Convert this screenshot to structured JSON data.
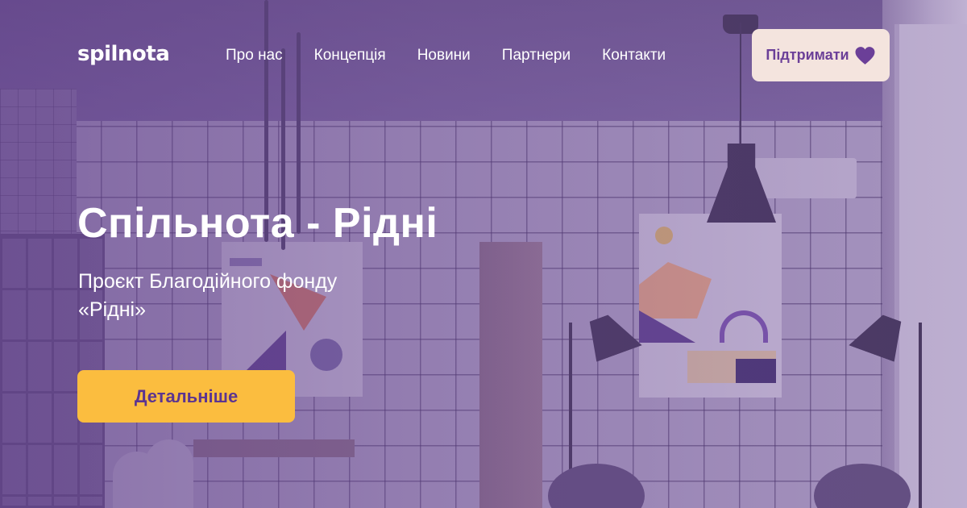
{
  "header": {
    "logo": "spilnota",
    "nav": [
      {
        "label": "Про нас"
      },
      {
        "label": "Концепція"
      },
      {
        "label": "Новини"
      },
      {
        "label": "Партнери"
      },
      {
        "label": "Контакти"
      }
    ],
    "support_button": {
      "label": "Підтримати",
      "icon": "heart-icon"
    }
  },
  "hero": {
    "title": "Спільнота - Рідні",
    "subtitle": "Проєкт Благодійного фонду «Рідні»",
    "cta_label": "Детальніше"
  },
  "colors": {
    "overlay": "#6a4a96",
    "support_bg": "#f4e4de",
    "support_text": "#6b3f98",
    "cta_bg": "#fbbd3f",
    "cta_text": "#5c3590"
  }
}
